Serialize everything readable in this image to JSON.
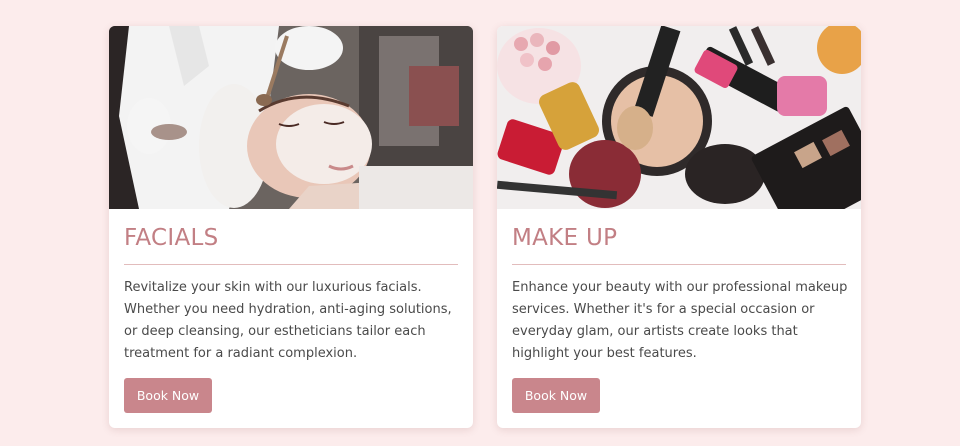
{
  "theme": {
    "accent": "#c9868c",
    "heading_color": "#c27f84",
    "page_background": "#fcecec"
  },
  "cards": [
    {
      "title": "FACIALS",
      "description": "Revitalize your skin with our luxurious facials. Whether you need hydration, anti-aging solutions, or deep cleansing, our estheticians tailor each treatment for a radiant complexion.",
      "button_label": "Book Now"
    },
    {
      "title": "MAKE UP",
      "description": "Enhance your beauty with our professional makeup services. Whether it's for a special occasion or everyday glam, our artists create looks that highlight your best features.",
      "button_label": "Book Now"
    }
  ]
}
